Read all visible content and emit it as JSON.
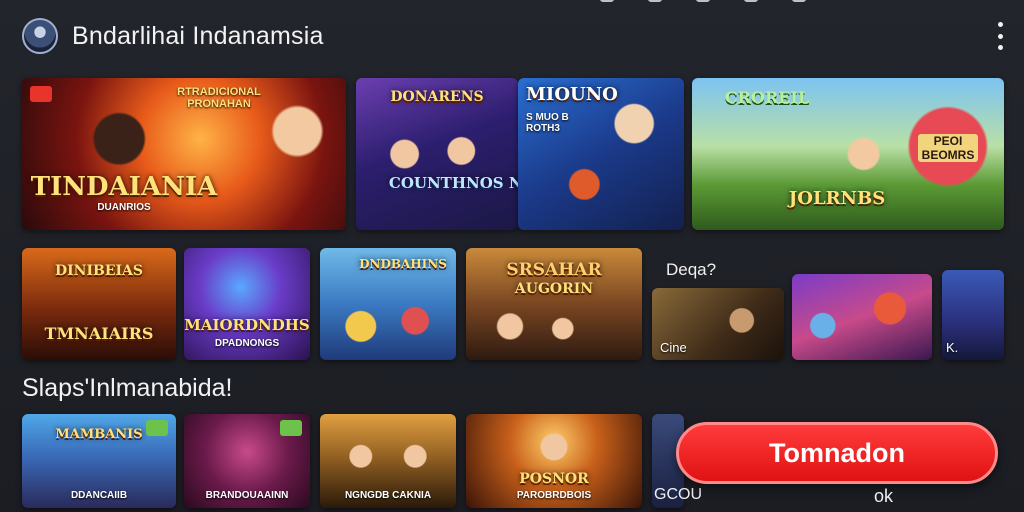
{
  "header": {
    "app_title": "Bndarlihai Indanamsia"
  },
  "featured": [
    {
      "title": "TINDAIANIA",
      "subtitle": "DUANRIOS",
      "badge_text": "RTRADICIONAL PRONAHAN"
    },
    {
      "title": "COUNTHNOS NEBIONANKES",
      "badge_text": "DONARENS"
    },
    {
      "title": "MIOUNO",
      "badge_text": "S MUO B ROTH3"
    },
    {
      "title": "JOLRNBS",
      "badge_text": "CROREIL",
      "side_text": "PEOI BEOMRS"
    }
  ],
  "row2": [
    {
      "title": "DINIBEIAS",
      "subtitle": "TMNAIAIRS"
    },
    {
      "title": "MAIORDNDHS",
      "subtitle": "DPADNONGS"
    },
    {
      "title": "DNDBAHINS"
    },
    {
      "title": "SRSAHAR",
      "subtitle": "AUGORIN"
    },
    {
      "overline": "Deqa?",
      "caption": "Cine"
    },
    {
      "title": ""
    },
    {
      "caption": "K."
    }
  ],
  "section": {
    "title": "Slaps'Inlmanabida!"
  },
  "row3": [
    {
      "title": "MAMBANIS",
      "caption": "DDANCAIIB"
    },
    {
      "caption": "BRANDOUAAINN"
    },
    {
      "caption": "NGNGDB CAKNIA"
    },
    {
      "title": "POSNOR",
      "caption": "PAROBRDBOIS"
    },
    {
      "caption": "GCOU"
    }
  ],
  "cta": {
    "label": "Tomnadon",
    "aside": "ok"
  },
  "colors": {
    "background": "#1c1e24",
    "cta": "#e01212",
    "title_gold": "#ffe27a"
  }
}
